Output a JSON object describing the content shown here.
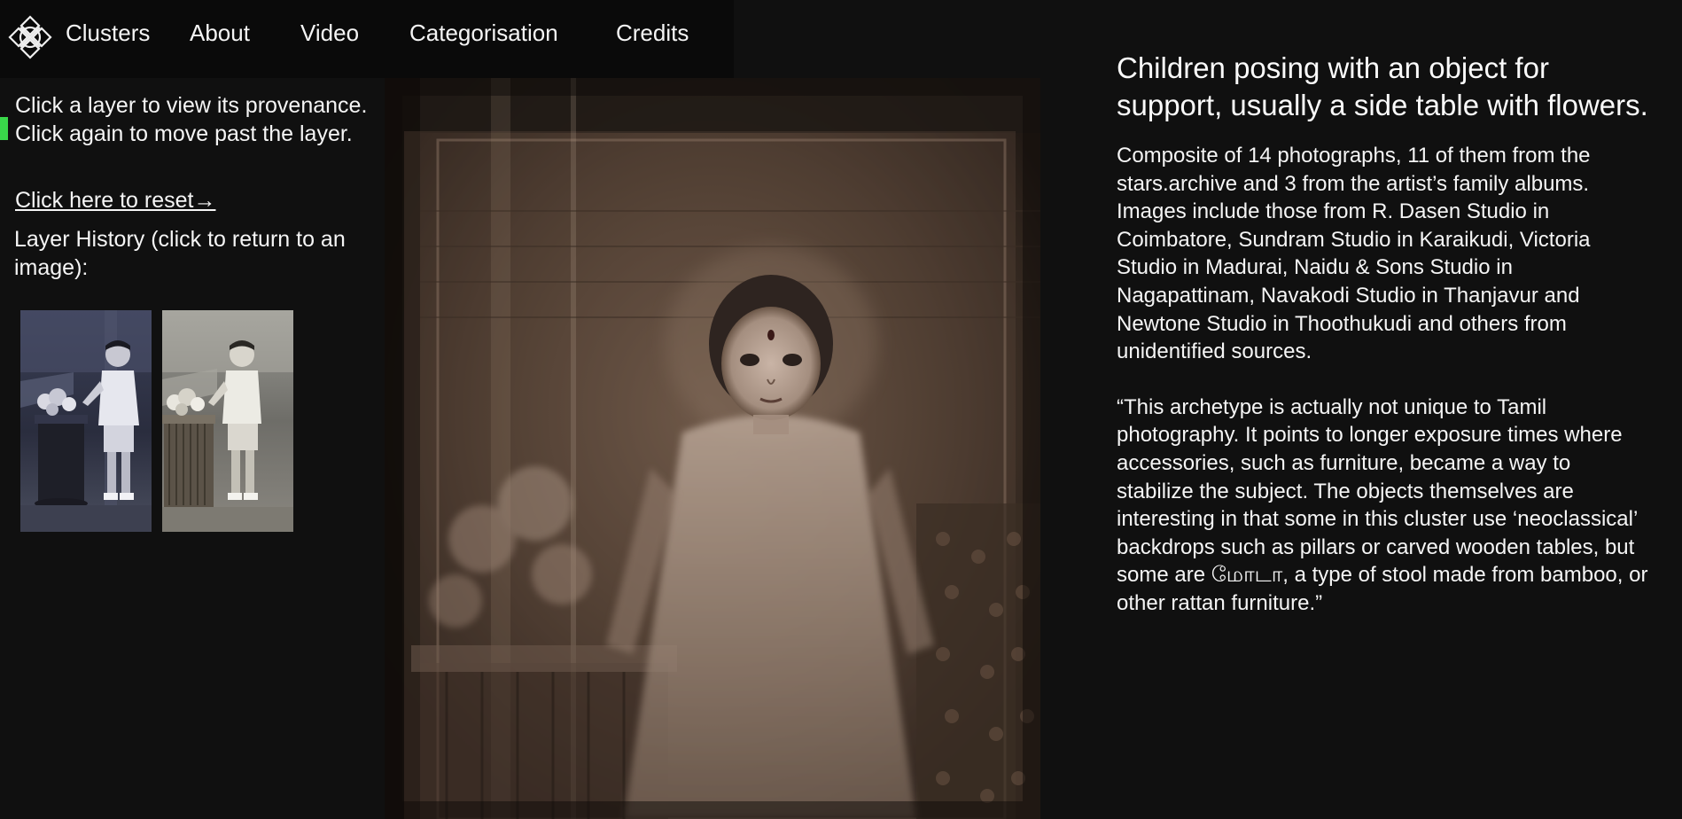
{
  "nav": {
    "logo_icon": "lattice-knot-logo",
    "items": [
      {
        "label": "Clusters"
      },
      {
        "label": "About"
      },
      {
        "label": "Video"
      },
      {
        "label": "Categorisation"
      },
      {
        "label": "Credits"
      }
    ]
  },
  "left": {
    "instructions": "Click a layer to view its provenance. Click again to move past the layer.",
    "reset_link": "Click here to reset→",
    "history_label": "Layer History (click to return to an image):"
  },
  "main": {
    "title": "Children posing with an object for support, usually a side table with flowers.",
    "description": "Composite of 14 photographs, 11 of them from the stars.archive and 3 from the artist’s family albums. Images include those from R. Dasen Studio in Coimbatore, Sundram Studio in Karaikudi, Victoria Studio in Madurai, Naidu & Sons Studio in Nagapattinam, Navakodi Studio in Thanjavur and Newtone Studio in Thoothukudi and others from unidentified sources.",
    "quote": "“This archetype is actually not unique to Tamil photography. It points to longer exposure times where accessories, such as furniture, became a way to stabilize the subject. The objects themselves are interesting in that some in this cluster use ‘neoclassical’ backdrops such as pillars or carved wooden tables, but some are மோடா, a type of stool made from bamboo, or other rattan furniture.”"
  },
  "colors": {
    "background": "#101010",
    "nav_background": "#0a0a0a",
    "accent": "#39d84a",
    "text": "#f5f5f5",
    "sepia": "#6b5443"
  }
}
